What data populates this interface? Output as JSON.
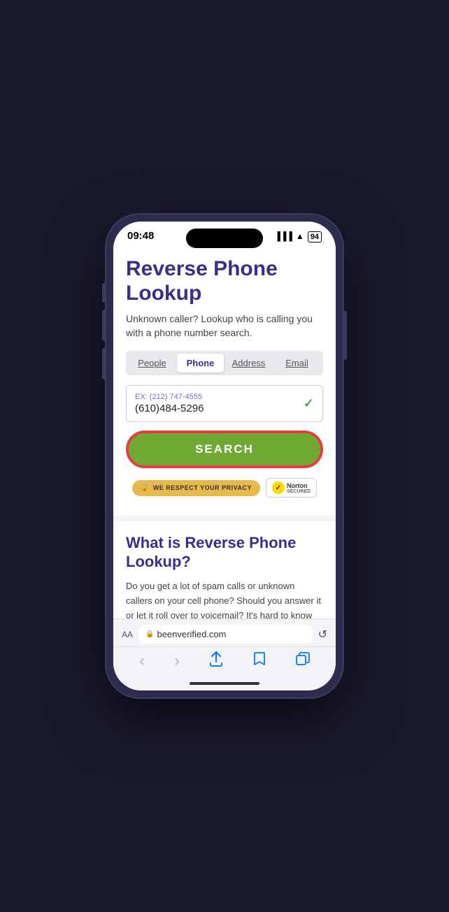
{
  "status_bar": {
    "time": "09:48",
    "battery": "94",
    "signal": "●●●",
    "wifi": "WiFi",
    "mute_icon": "🔔"
  },
  "page": {
    "title": "Reverse Phone Lookup",
    "subtitle": "Unknown caller? Lookup who is calling you with a phone number search."
  },
  "tabs": [
    {
      "label": "People",
      "active": false
    },
    {
      "label": "Phone",
      "active": true
    },
    {
      "label": "Address",
      "active": false
    },
    {
      "label": "Email",
      "active": false
    }
  ],
  "search_field": {
    "example_label": "EX: (212) 747-4555",
    "value": "(610)484-5296",
    "checkmark": "✓"
  },
  "search_button": {
    "label": "SEARCH"
  },
  "privacy_badge": {
    "label": "WE RESPECT YOUR PRIVACY",
    "lock": "🔒"
  },
  "norton_badge": {
    "label": "Norton",
    "sublabel": "SECURED",
    "checkmark": "✓"
  },
  "bottom_section": {
    "title_normal": "What is Reverse",
    "title_bold": "Phone",
    "title_end": "Lookup?",
    "body": "Do you get a lot of spam calls or unknown callers on your cell phone? Should you answer it or let it roll over to voicemail? It's hard to know what to do if you don't know who's"
  },
  "browser_bar": {
    "aa_label": "AA",
    "url": "beenverified.com",
    "lock": "🔒",
    "reload": "↺"
  },
  "bottom_nav": {
    "back": "‹",
    "forward": "›",
    "share": "↑",
    "bookmarks": "📖",
    "tabs": "⧉"
  }
}
